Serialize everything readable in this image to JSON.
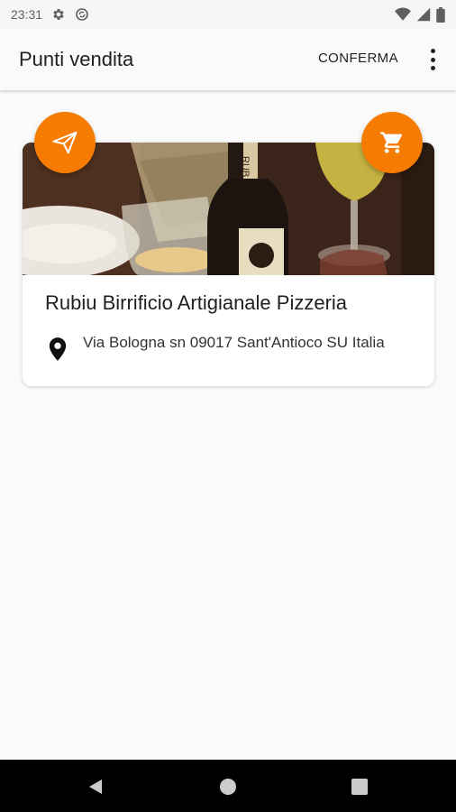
{
  "status_bar": {
    "time": "23:31"
  },
  "app_bar": {
    "title": "Punti vendita",
    "confirm_label": "CONFERMA"
  },
  "store": {
    "name": "Rubiu Birrificio Artigianale Pizzeria",
    "address": "Via Bologna sn 09017 Sant'Antioco SU Italia",
    "photo_label": "RUB"
  },
  "colors": {
    "accent": "#f57c00",
    "background": "#fafafa",
    "text": "#212121"
  },
  "icons": {
    "send": "send-icon",
    "cart": "cart-icon",
    "pin": "location-pin-icon",
    "more": "more-vert-icon"
  }
}
